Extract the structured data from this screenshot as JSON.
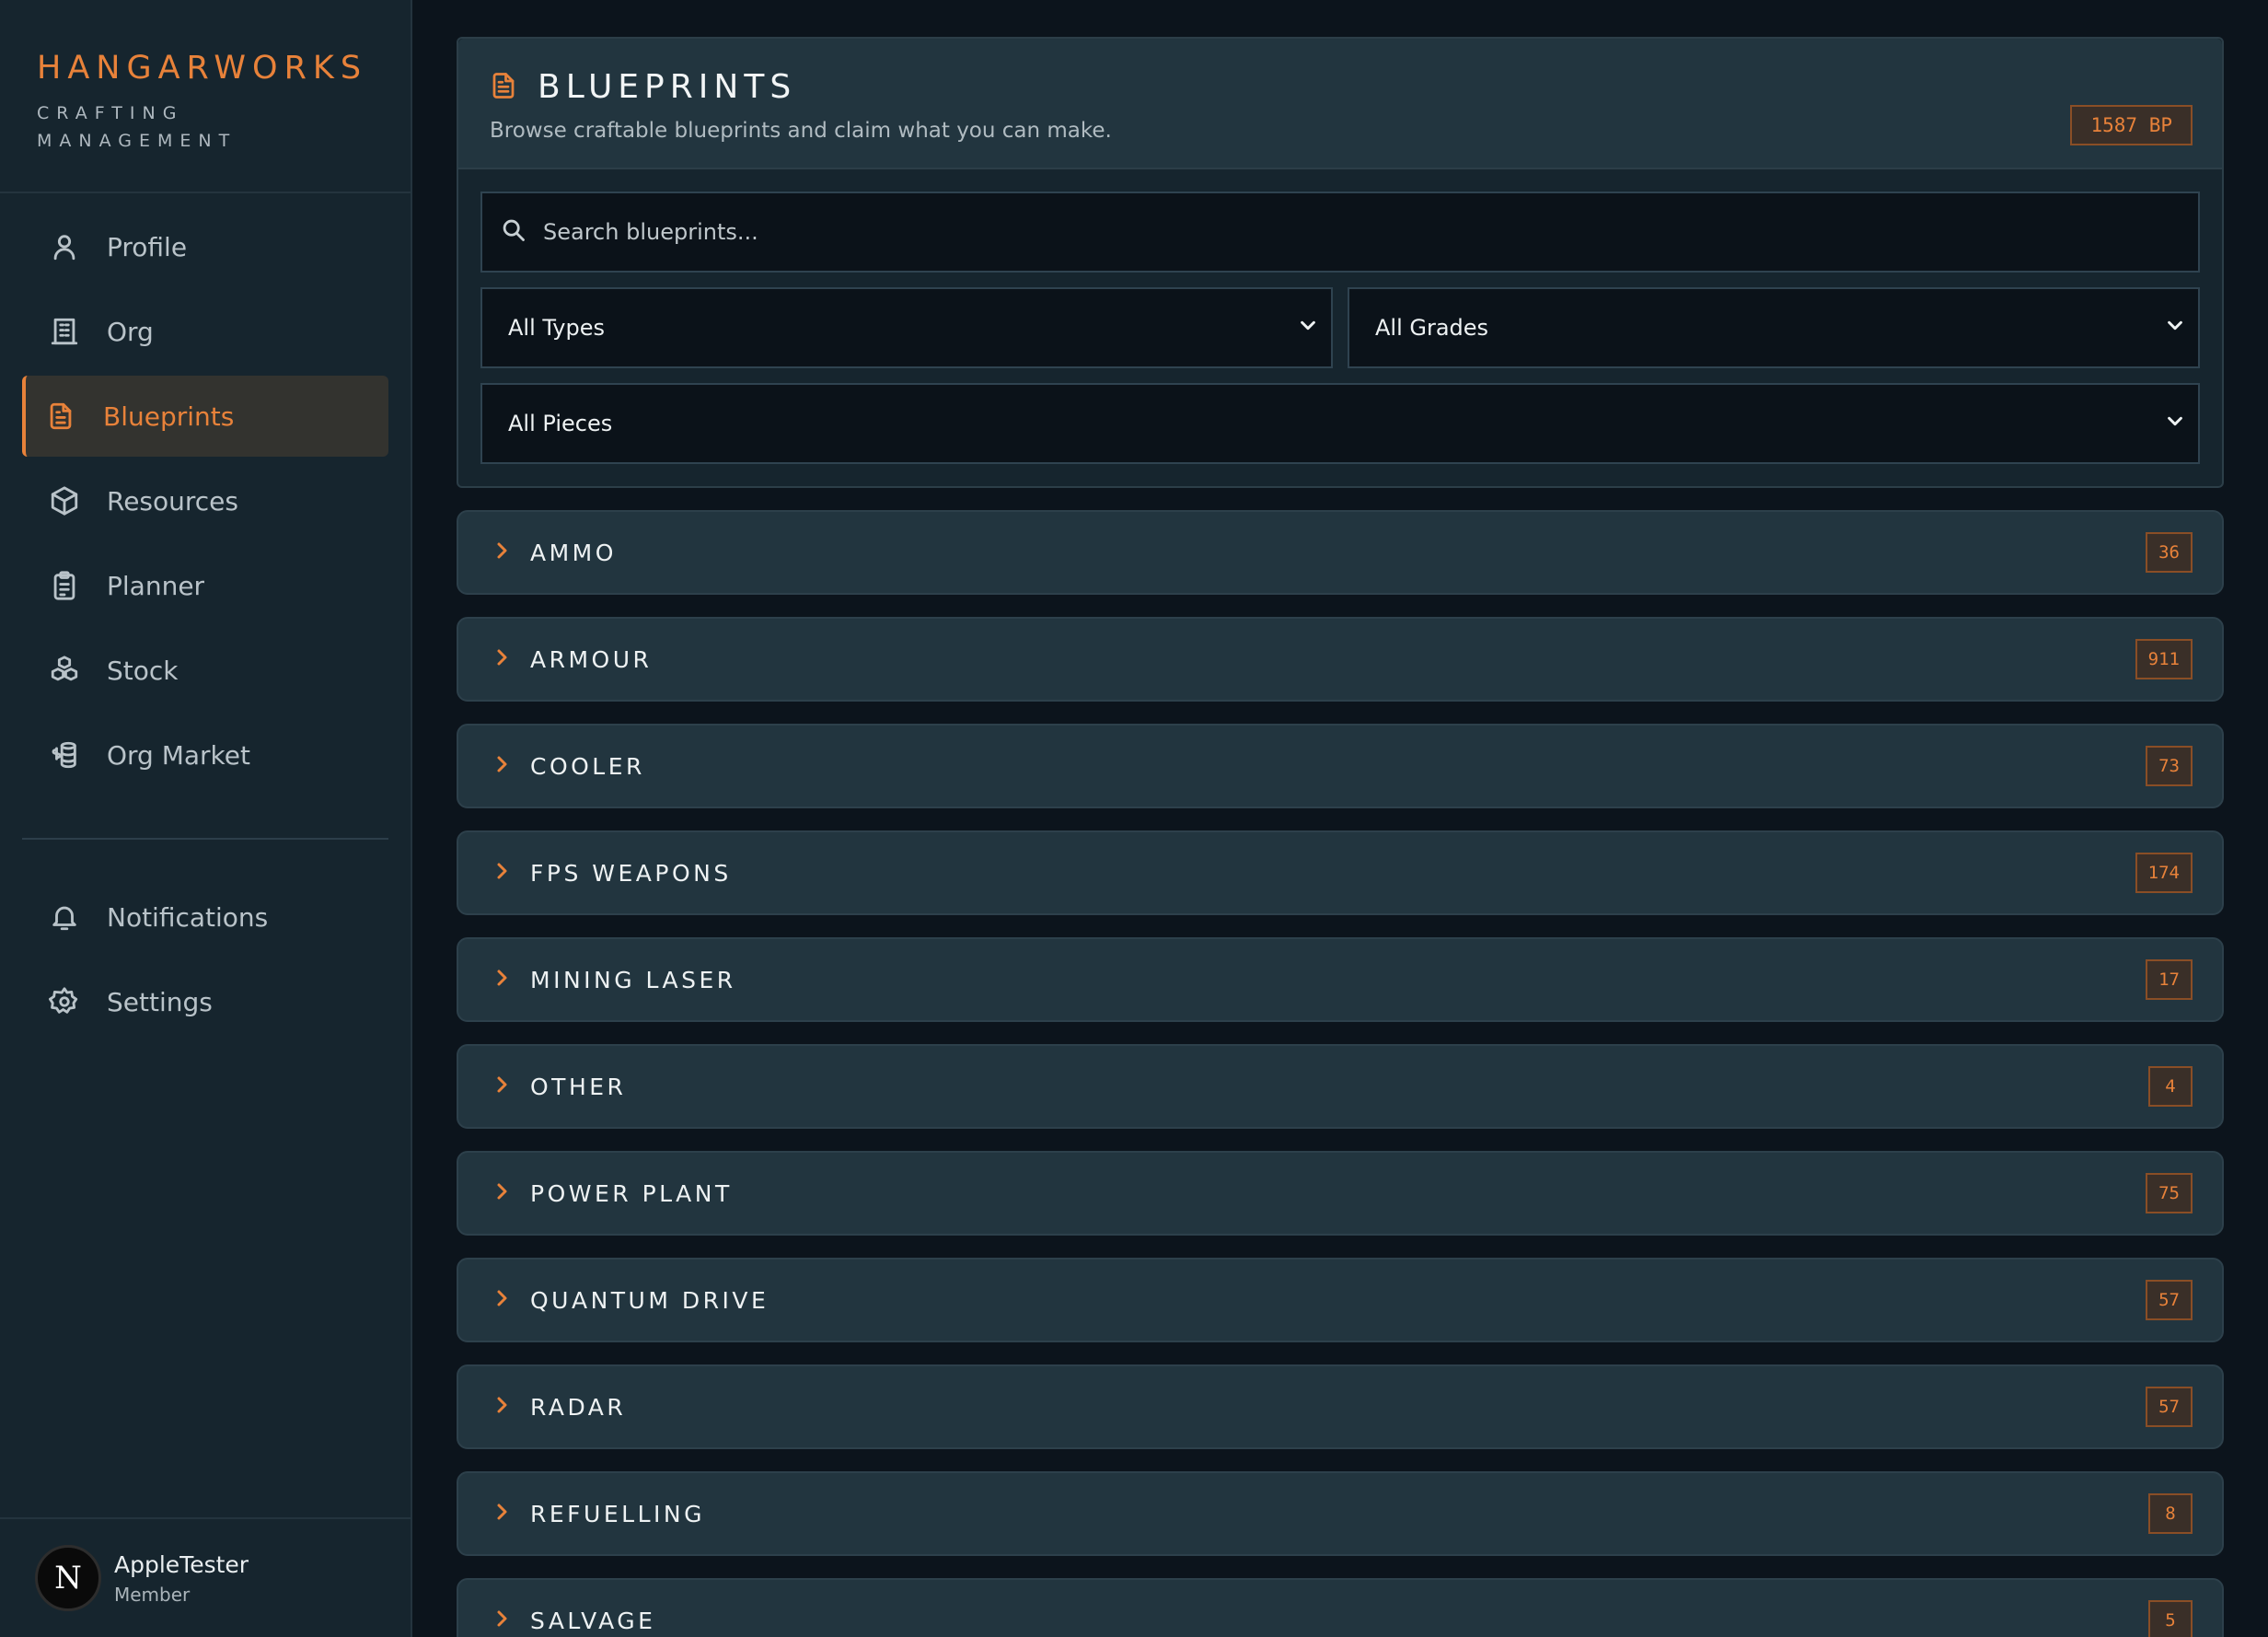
{
  "brand": {
    "title": "HANGARWORKS",
    "subtitle": "CRAFTING MANAGEMENT"
  },
  "nav": {
    "items": [
      {
        "label": "Profile",
        "icon": "user-icon"
      },
      {
        "label": "Org",
        "icon": "building-icon"
      },
      {
        "label": "Blueprints",
        "icon": "document-icon",
        "active": true
      },
      {
        "label": "Resources",
        "icon": "cube-icon"
      },
      {
        "label": "Planner",
        "icon": "clipboard-icon"
      },
      {
        "label": "Stock",
        "icon": "boxes-icon"
      },
      {
        "label": "Org Market",
        "icon": "coins-icon"
      }
    ],
    "secondary": [
      {
        "label": "Notifications",
        "icon": "bell-icon"
      },
      {
        "label": "Settings",
        "icon": "gear-icon"
      }
    ]
  },
  "user": {
    "initial": "N",
    "name": "AppleTester",
    "role": "Member"
  },
  "header": {
    "title": "BLUEPRINTS",
    "subtitle": "Browse craftable blueprints and claim what you can make.",
    "badge": "1587 BP"
  },
  "search": {
    "placeholder": "Search blueprints..."
  },
  "filters": {
    "types": "All Types",
    "grades": "All Grades",
    "pieces": "All Pieces"
  },
  "categories": [
    {
      "label": "AMMO",
      "count": "36"
    },
    {
      "label": "ARMOUR",
      "count": "911"
    },
    {
      "label": "COOLER",
      "count": "73"
    },
    {
      "label": "FPS WEAPONS",
      "count": "174"
    },
    {
      "label": "MINING LASER",
      "count": "17"
    },
    {
      "label": "OTHER",
      "count": "4"
    },
    {
      "label": "POWER PLANT",
      "count": "75"
    },
    {
      "label": "QUANTUM DRIVE",
      "count": "57"
    },
    {
      "label": "RADAR",
      "count": "57"
    },
    {
      "label": "REFUELLING",
      "count": "8"
    },
    {
      "label": "SALVAGE",
      "count": "5"
    }
  ],
  "colors": {
    "accent": "#e8823a",
    "background": "#0c141c",
    "panel": "#22353f",
    "sidebar": "#16252e"
  }
}
